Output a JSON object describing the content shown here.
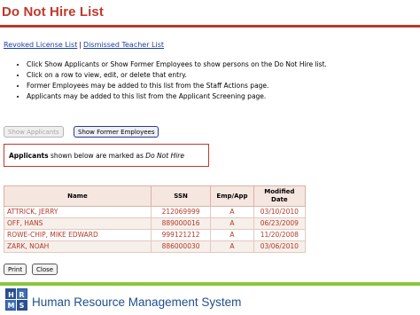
{
  "page": {
    "title": "Do Not Hire List"
  },
  "links": {
    "revoked": "Revoked License List",
    "separator": "|",
    "dismissed": "Dismissed Teacher List"
  },
  "instructions": [
    "Click Show Applicants or Show Former Employees to show persons on the Do Not Hire list.",
    "Click on a row to view, edit, or delete that entry.",
    "Former Employees may be added to this list from the Staff Actions page.",
    "Applicants may be added to this list from the Applicant Screening page."
  ],
  "buttons": {
    "show_applicants": "Show Applicants",
    "show_former_employees": "Show Former Employees",
    "print": "Print",
    "close": "Close"
  },
  "notice": {
    "bold": "Applicants",
    "middle": " shown below are marked as ",
    "italic": "Do Not Hire"
  },
  "table": {
    "headers": [
      "Name",
      "SSN",
      "Emp/App",
      "Modified Date"
    ],
    "rows": [
      [
        "ATTRICK, JERRY",
        "212069999",
        "A",
        "03/10/2010"
      ],
      [
        "OFF, HANS",
        "889000016",
        "A",
        "06/23/2009"
      ],
      [
        "ROWE-CHIP, MIKE EDWARD",
        "999121212",
        "A",
        "11/20/2008"
      ],
      [
        "ZARK, NOAH",
        "886000030",
        "A",
        "03/06/2010"
      ]
    ]
  },
  "footer": {
    "system_name": "Human Resource Management System",
    "logo_letters": [
      "H",
      "R",
      "M",
      "S"
    ]
  },
  "colors": {
    "title_red": "#c0392b",
    "row_text": "#b23a2a",
    "footer_green": "#8dc63f",
    "footer_blue": "#1f4e8c",
    "link_blue": "#1a3f9e"
  }
}
